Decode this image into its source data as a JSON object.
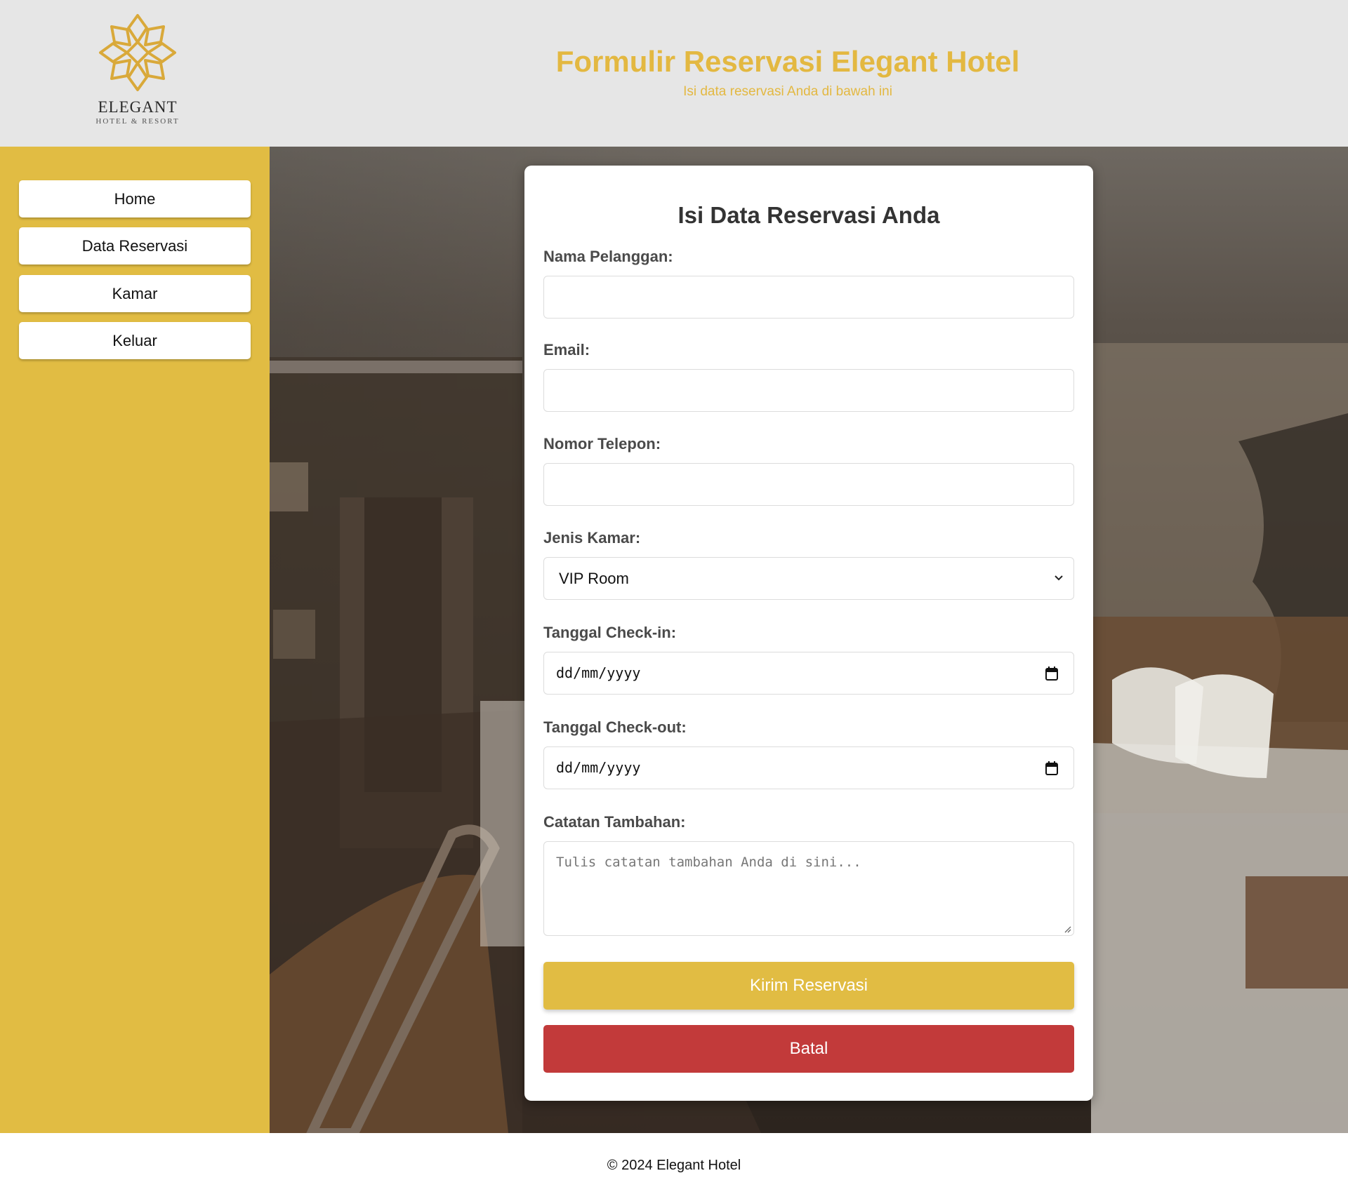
{
  "header": {
    "logo_name": "ELEGANT",
    "logo_tagline": "HOTEL & RESORT",
    "title": "Formulir Reservasi Elegant Hotel",
    "subtitle": "Isi data reservasi Anda di bawah ini",
    "accent_color": "#e3b841"
  },
  "sidebar": {
    "background_color": "#e1bc43",
    "items": [
      {
        "label": "Home"
      },
      {
        "label": "Data Reservasi"
      },
      {
        "label": "Kamar"
      },
      {
        "label": "Keluar"
      }
    ]
  },
  "form": {
    "title": "Isi Data Reservasi Anda",
    "name_label": "Nama Pelanggan:",
    "name_value": "",
    "email_label": "Email:",
    "email_value": "",
    "phone_label": "Nomor Telepon:",
    "phone_value": "",
    "room_label": "Jenis Kamar:",
    "room_value": "VIP Room",
    "checkin_label": "Tanggal Check-in:",
    "checkin_value": "dd/mm/yyyy",
    "checkout_label": "Tanggal Check-out:",
    "checkout_value": "dd/mm/yyyy",
    "notes_label": "Catatan Tambahan:",
    "notes_placeholder": "Tulis catatan tambahan Anda di sini...",
    "submit_label": "Kirim Reservasi",
    "cancel_label": "Batal",
    "submit_color": "#e1bc43",
    "cancel_color": "#c23a3a"
  },
  "footer": {
    "text": "© 2024 Elegant Hotel"
  },
  "icons": {
    "logo": "lotus-mandala-icon",
    "select": "chevron-down-icon",
    "date": "calendar-icon",
    "resize": "resize-grip-icon"
  }
}
